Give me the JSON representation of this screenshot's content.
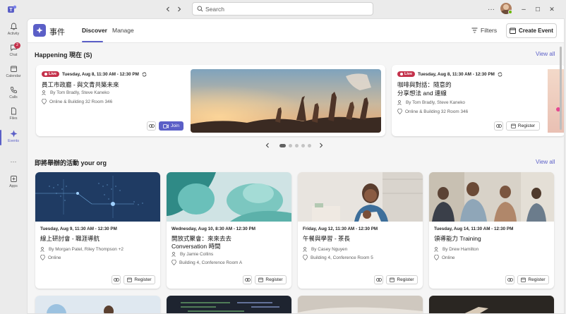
{
  "titlebar": {
    "search_placeholder": "Search",
    "more": "···",
    "min": "–",
    "max": "☐",
    "close": "✕"
  },
  "rail": {
    "items": [
      {
        "label": "Activity",
        "icon": "bell-icon"
      },
      {
        "label": "Chat",
        "icon": "chat-icon",
        "badge": "2"
      },
      {
        "label": "Calendar",
        "icon": "calendar-icon"
      },
      {
        "label": "Calls",
        "icon": "phone-icon"
      },
      {
        "label": "Files",
        "icon": "file-icon"
      },
      {
        "label": "Events",
        "icon": "events-icon"
      },
      {
        "label": "···",
        "icon": "more-icon"
      },
      {
        "label": "Apps",
        "icon": "apps-icon"
      }
    ],
    "accent": "#5b5fc7"
  },
  "header": {
    "app_title": "事件",
    "tabs": [
      "Discover",
      "Manage"
    ],
    "filters": "Filters",
    "create_event": "Create Event"
  },
  "happening": {
    "title": "Happening 現在 (S)",
    "view_all": "View all",
    "cards": [
      {
        "live": "Live",
        "datetime": "Tuesday, Aug 8, 11:30 AM - 12:30 PM",
        "title": "員工市政廳            - 與文青共築未來",
        "people": "By Tom Bradly, Steve Kaneko",
        "location": "Online & Building 32 Room 346",
        "join": "Join"
      },
      {
        "live": "Live",
        "datetime": "Tuesday, Aug 8, 11:30 AM - 12:30 PM",
        "title_line1": "咖啡與對話：隨意的",
        "title_line2": "分享想法      and 連線",
        "people": "By Tom Bradly, Steve Kaneko",
        "location": "Online & Building 32 Room 346",
        "register": "Register"
      }
    ]
  },
  "upcoming": {
    "title": "即將舉辦的活動       your org",
    "view_all": "View all",
    "cards": [
      {
        "datetime": "Tuesday, Aug 9, 11:30 AM - 12:30 PM",
        "title": "線上研討會 - 職涯導航",
        "people": "By Morgan Patel, Riley Thompson +2",
        "location": "Online",
        "register": "Register"
      },
      {
        "datetime": "Wednesday, Aug 10, 8:30 AM - 12:30 PM",
        "title_line1": "開放式聚會：來來去去",
        "title_line2": "Conversation 時間",
        "people": "By Jamie Collins",
        "location": "Building 4, Conference Room A",
        "register": "Register"
      },
      {
        "datetime": "Friday, Aug 12, 11:30 AM - 12:30 PM",
        "title": "午餐與學習 - 茶長",
        "people": "By Casey Nguyen",
        "location": "Building 4, Conference Room 5",
        "register": "Register"
      },
      {
        "datetime": "Tuesday, Aug 14, 11:30 AM - 12:30 PM",
        "title": "領導能力       Training",
        "people": "By Drew Hamilton",
        "location": "Online",
        "register": "Register"
      }
    ]
  }
}
